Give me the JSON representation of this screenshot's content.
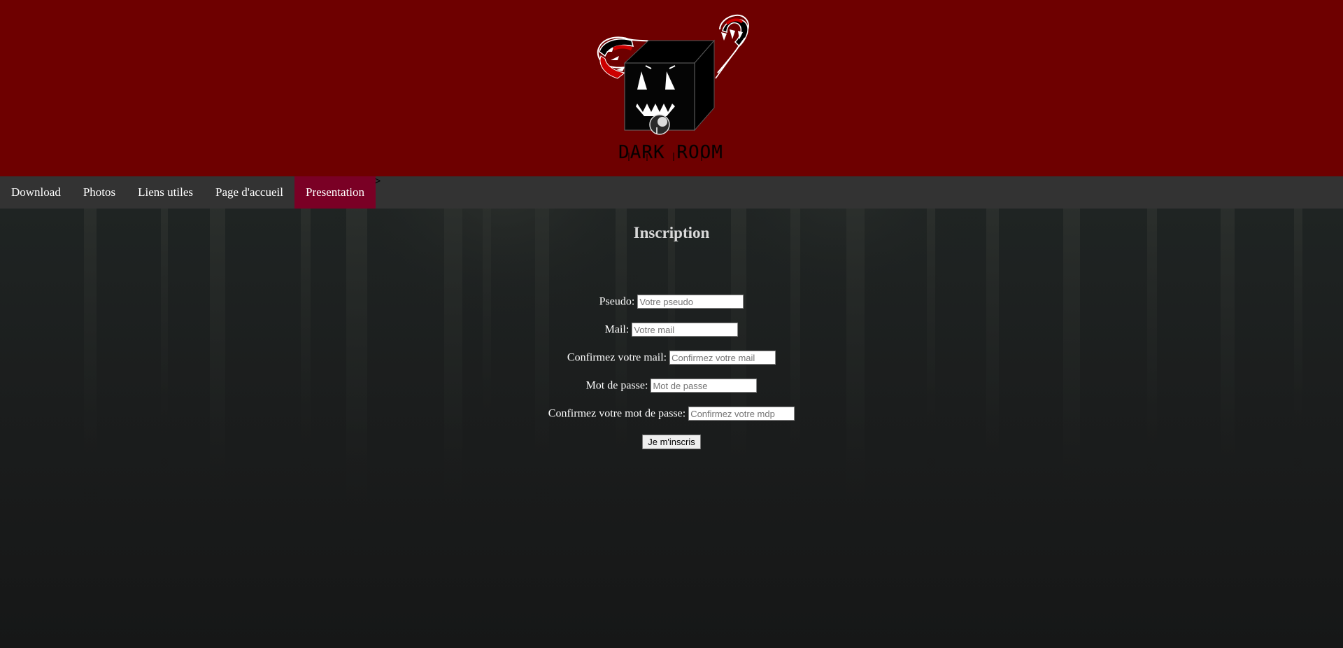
{
  "header": {
    "logo_icon": "dark-room-monster-box-logo",
    "logo_text": "DARK ROOM",
    "background_color": "#6e0000"
  },
  "nav": {
    "items": [
      {
        "label": "Download"
      },
      {
        "label": "Photos"
      },
      {
        "label": "Liens utiles"
      },
      {
        "label": "Page d'accueil"
      },
      {
        "label": "Presentation",
        "active": true
      }
    ],
    "stray_text": ">",
    "background_color": "#333333",
    "active_color": "#7a0025"
  },
  "form": {
    "title": "Inscription",
    "fields": [
      {
        "label": "Pseudo:",
        "placeholder": "Votre pseudo"
      },
      {
        "label": "Mail:",
        "placeholder": "Votre mail"
      },
      {
        "label": "Confirmez votre mail:",
        "placeholder": "Confirmez votre mail"
      },
      {
        "label": "Mot de passe:",
        "placeholder": "Mot de passe"
      },
      {
        "label": "Confirmez votre mot de passe:",
        "placeholder": "Confirmez votre mdp"
      }
    ],
    "submit_label": "Je m'inscris"
  }
}
